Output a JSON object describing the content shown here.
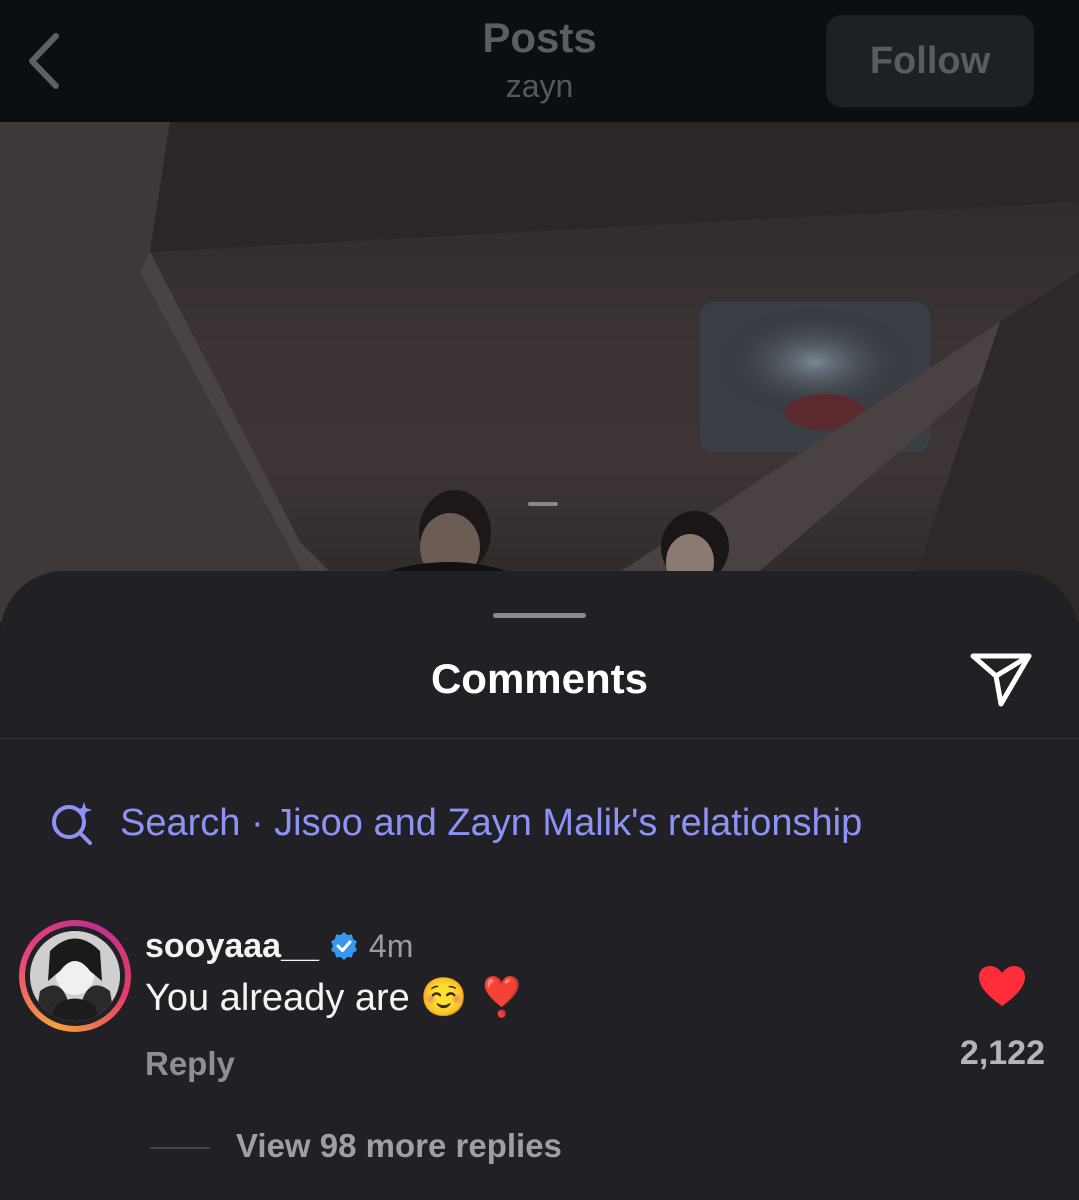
{
  "header": {
    "title": "Posts",
    "subtitle": "zayn",
    "follow_label": "Follow"
  },
  "comments_sheet": {
    "title": "Comments",
    "search_suggestion": "Search · Jisoo and Zayn Malik's relationship",
    "comment": {
      "username": "sooyaaa__",
      "verified": true,
      "time": "4m",
      "text": "You already are ☺️ ❣️",
      "reply_label": "Reply",
      "like_count": "2,122",
      "liked": true,
      "view_replies_label": "View 98 more replies"
    }
  },
  "colors": {
    "accent_search": "#8d93f5",
    "like_red": "#ff2d3a",
    "verified_blue": "#3897f0"
  }
}
